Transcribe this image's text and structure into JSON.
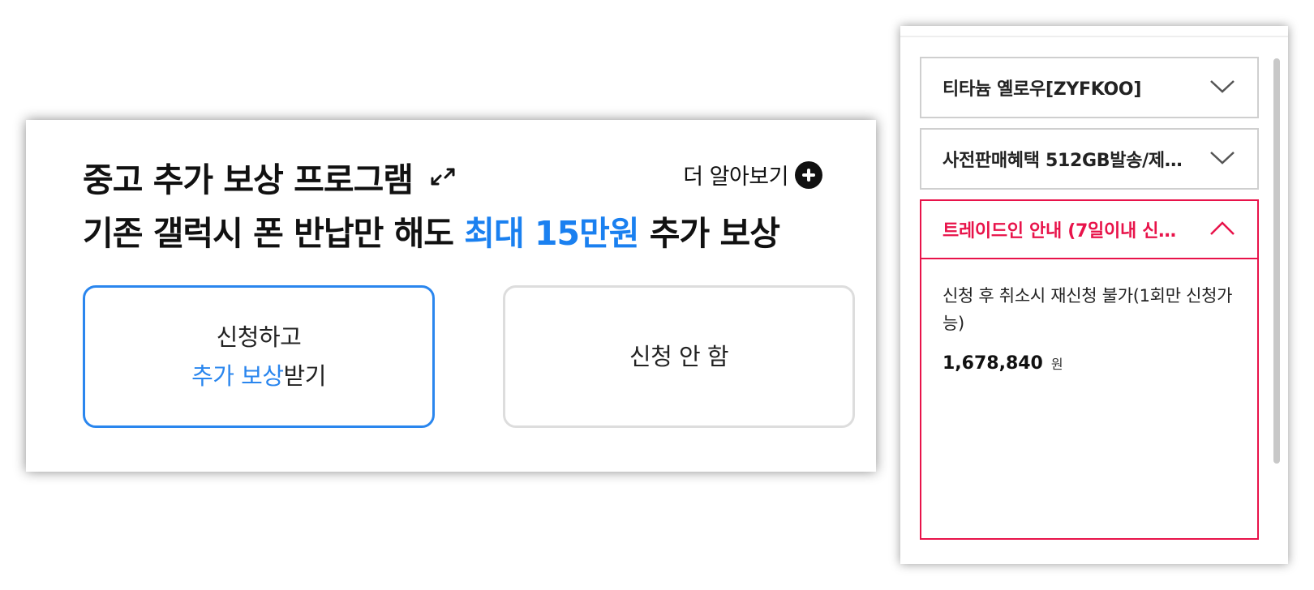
{
  "program": {
    "title": "중고 추가 보상 프로그램",
    "learn_more": "더 알아보기",
    "subtitle_prefix": "기존 갤럭시 폰 반납만 해도 ",
    "subtitle_highlight": "최대 15만원",
    "subtitle_suffix": " 추가 보상",
    "accent_color": "#1a80f0"
  },
  "options": {
    "apply_line1": "신청하고",
    "apply_line2_highlight": "추가 보상",
    "apply_line2_rest": "받기",
    "decline": "신청 안 함"
  },
  "panel": {
    "color_select": "티타늄 옐로우[ZYFKOO]",
    "benefit_select": "사전판매혜택 512GB발송/제…",
    "tradein_title": "트레이드인 안내 (7일이내 신…",
    "tradein_notice": "신청 후 취소시 재신청 불가(1회만 신청가능)",
    "price": "1,678,840",
    "price_unit": "원",
    "active_color": "#e8134a"
  },
  "icons": {
    "swap": "swap-arrows-icon",
    "plus": "plus-circle-icon",
    "chevron_down": "chevron-down-icon",
    "chevron_up": "chevron-up-icon"
  }
}
